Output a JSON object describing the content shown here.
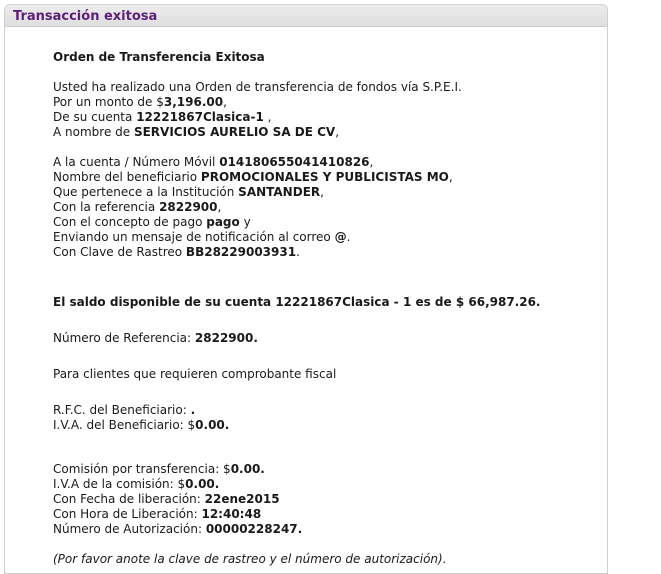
{
  "header": {
    "title": "Transacción exitosa"
  },
  "order": {
    "heading": "Orden de Transferencia Exitosa",
    "intro": "Usted ha realizado una Orden de transferencia de fondos vía S.P.E.I.",
    "amount_prefix": "Por un monto de $",
    "amount_value": "3,196.00",
    "amount_suffix": ",",
    "from_prefix": "De su cuenta ",
    "from_value": "12221867Clasica-1",
    "from_suffix": " ,",
    "name_prefix": "A nombre de ",
    "name_value": "SERVICIOS AURELIO SA DE CV",
    "name_suffix": ","
  },
  "destination": {
    "account_prefix": "A la cuenta / Número Móvil ",
    "account_value": "014180655041410826",
    "account_suffix": ",",
    "beneficiary_prefix": "Nombre del beneficiario ",
    "beneficiary_value": "PROMOCIONALES Y PUBLICISTAS MO",
    "beneficiary_suffix": ",",
    "institution_prefix": "Que pertenece a la Institución ",
    "institution_value": "SANTANDER",
    "institution_suffix": ",",
    "reference_prefix": "Con la referencia ",
    "reference_value": "2822900",
    "reference_suffix": ",",
    "concept_prefix": "Con el concepto de pago ",
    "concept_value": "pago",
    "concept_suffix": " y",
    "email_prefix": "Enviando un mensaje de notificación al correo ",
    "email_value": "@",
    "email_suffix": ".",
    "tracking_prefix": "Con Clave de Rastreo ",
    "tracking_value": "BB28229003931",
    "tracking_suffix": "."
  },
  "balance": {
    "text": "El saldo disponible de su cuenta 12221867Clasica - 1 es de $ 66,987.26."
  },
  "reference": {
    "label": "Número de Referencia: ",
    "value": "2822900."
  },
  "fiscal": {
    "note": "Para clientes que requieren comprobante fiscal",
    "rfc_label": "R.F.C. del Beneficiario: ",
    "rfc_value": ".",
    "iva_label": "I.V.A. del Beneficiario: $",
    "iva_value": "0.00."
  },
  "fees": {
    "commission_label": "Comisión por transferencia: $",
    "commission_value": "0.00.",
    "iva_label": "I.V.A de la comisión: $",
    "iva_value": "0.00.",
    "date_label": "Con Fecha de liberación: ",
    "date_value": "22ene2015",
    "time_label": "Con Hora de Liberación: ",
    "time_value": "12:40:48",
    "auth_label": "Número de Autorización: ",
    "auth_value": "00000228247."
  },
  "footer_note": "(Por favor anote la clave de rastreo y el número de autorización)."
}
